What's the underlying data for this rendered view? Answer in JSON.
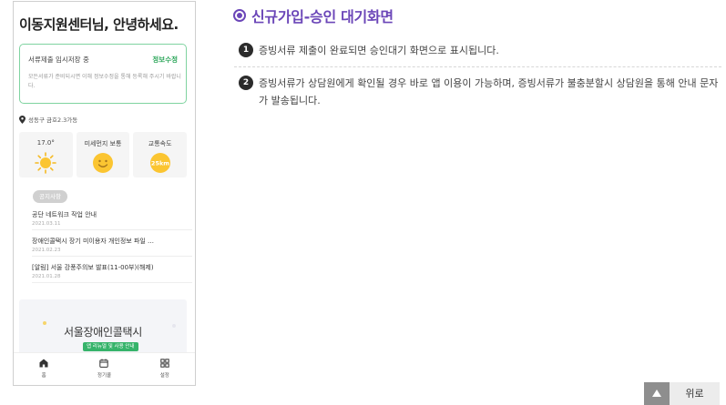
{
  "phone": {
    "greeting": "이동지원센터님, 안녕하세요.",
    "notice_card": {
      "title": "서류제출 임시저장 중",
      "link": "정보수정",
      "desc": "모든서류가 준비되시면 이해 정보수정을 통해 등록해 주시기 바랍니다."
    },
    "location": "성동구 금호2.3가동",
    "weather": [
      {
        "label": "17.0°",
        "icon": "sun-icon"
      },
      {
        "label": "미세먼지 보통",
        "icon": "smile-icon"
      },
      {
        "label": "교통속도",
        "icon": "speed-icon",
        "value": "25km"
      }
    ],
    "notice_badge": "공지사항",
    "notices": [
      {
        "title": "공단 네트워크 작업 안내",
        "date": "2021.03.11"
      },
      {
        "title": "장애인콜택시 장기 미이용자 개인정보 파일 …",
        "date": "2021.02.23"
      },
      {
        "title": "[알림] 서울 강풍주의보 발표(11-00부)(해제)",
        "date": "2021.01.28"
      }
    ],
    "banner": {
      "title": "서울장애인콜택시",
      "tag": "앱 리뉴얼 및 사용 안내"
    },
    "tabs": [
      {
        "label": "홈",
        "icon": "home-icon"
      },
      {
        "label": "정기콜",
        "icon": "calendar-icon"
      },
      {
        "label": "설정",
        "icon": "grid-icon"
      }
    ]
  },
  "content": {
    "title": "신규가입-승인 대기화면",
    "steps": [
      {
        "num": "1",
        "text": "증빙서류 제출이 완료되면 승인대기 화면으로 표시됩니다."
      },
      {
        "num": "2",
        "text": "증빙서류가 상담원에게 확인될 경우 바로 앱 이용이 가능하며, 증빙서류가 불충분할시 상담원을 통해 안내 문자가 발송됩니다."
      }
    ]
  },
  "top_button": {
    "label": "위로"
  },
  "colors": {
    "accent": "#6b46b8",
    "green": "#36b36a"
  }
}
